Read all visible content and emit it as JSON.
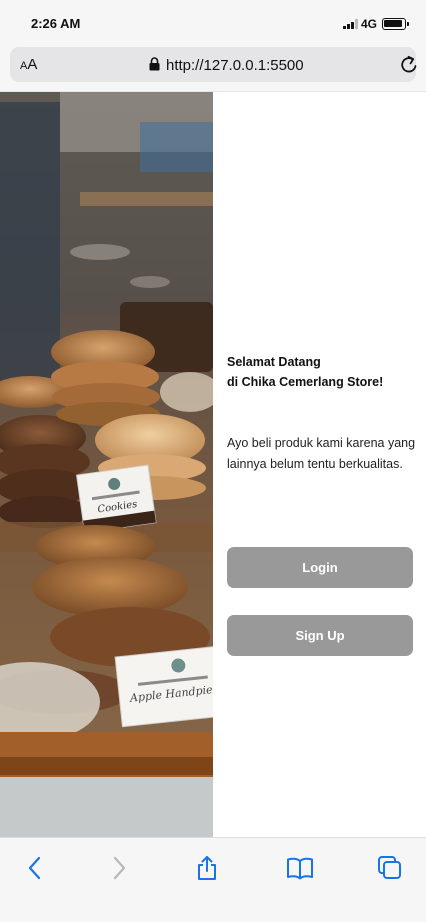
{
  "status_bar": {
    "time": "2:26 AM",
    "network": "4G"
  },
  "browser": {
    "aa_label": "AA",
    "url": "http://127.0.0.1:5500"
  },
  "hero": {
    "label_top": "Cookies",
    "label_bottom": "Apple Handpie"
  },
  "welcome": {
    "title_line1": "Selamat Datang",
    "title_line2": "di Chika Cemerlang Store!",
    "text": "Ayo beli produk kami karena yang lainnya belum tentu berkualitas."
  },
  "buttons": {
    "login": "Login",
    "signup": "Sign Up"
  },
  "colors": {
    "button": "#999999",
    "toolbar_icon": "#1a73e8",
    "accent_disabled": "#b8b8b8"
  },
  "toolbar_icons": [
    "back-icon",
    "forward-icon",
    "share-icon",
    "bookmarks-icon",
    "tabs-icon"
  ]
}
